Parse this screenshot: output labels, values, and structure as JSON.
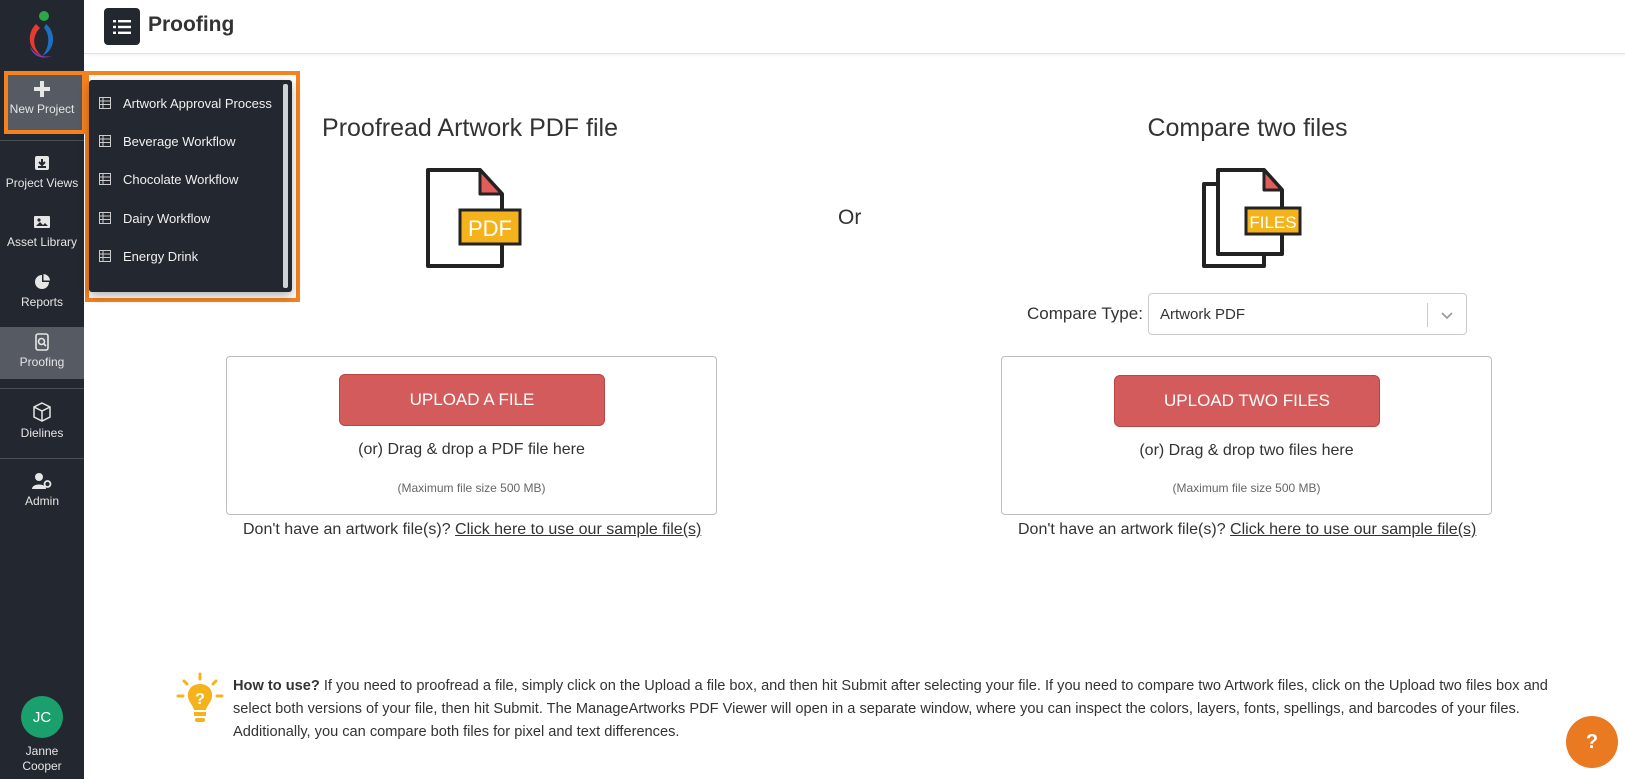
{
  "header": {
    "title": "Proofing"
  },
  "sidebar": {
    "items": [
      {
        "label": "New Project",
        "icon": "plus-icon"
      },
      {
        "label": "Project Views",
        "icon": "archive-icon"
      },
      {
        "label": "Asset Library",
        "icon": "image-icon"
      },
      {
        "label": "Reports",
        "icon": "pie-chart-icon"
      },
      {
        "label": "Proofing",
        "icon": "document-search-icon"
      },
      {
        "label": "Dielines",
        "icon": "box-icon"
      },
      {
        "label": "Admin",
        "icon": "user-gear-icon"
      }
    ],
    "user": {
      "initials": "JC",
      "name_line1": "Janne",
      "name_line2": "Cooper"
    }
  },
  "new_project_menu": {
    "items": [
      "Artwork Approval Process",
      "Beverage Workflow",
      "Chocolate Workflow",
      "Dairy Workflow",
      "Energy Drink"
    ]
  },
  "proofread": {
    "title": "Proofread Artwork PDF file",
    "icon_label": "PDF",
    "button": "UPLOAD A FILE",
    "drag_text": "(or) Drag & drop a PDF file here",
    "max_text": "(Maximum file size 500 MB)",
    "sample_prefix": "Don't have an artwork file(s)?",
    "sample_link": "Click here to use our sample file(s)"
  },
  "or_text": "Or",
  "compare": {
    "title": "Compare two files",
    "icon_label": "FILES",
    "type_label": "Compare Type:",
    "type_value": "Artwork PDF",
    "button": "UPLOAD TWO FILES",
    "drag_text": "(or) Drag & drop two files here",
    "max_text": "(Maximum file size 500 MB)",
    "sample_prefix": "Don't have an artwork file(s)?",
    "sample_link": "Click here to use our sample file(s)"
  },
  "howto": {
    "heading": "How to use?",
    "body": " If you need to proofread a file, simply click on the Upload a file box, and then hit Submit after selecting your file. If you need to compare two Artwork files, click on the Upload two files box and select both versions of your file, then hit Submit. The ManageArtworks PDF Viewer will open in a separate window, where you can inspect the colors, layers, fonts, spellings, and barcodes of your files. Additionally, you can compare both files for pixel and text differences."
  },
  "help_button": "?",
  "colors": {
    "sidebar": "#23272f",
    "highlight": "#f58220",
    "upload_button": "#d45b5b",
    "avatar": "#1aa06d",
    "help": "#ea7a22",
    "icon_yellow": "#f5b31b"
  }
}
